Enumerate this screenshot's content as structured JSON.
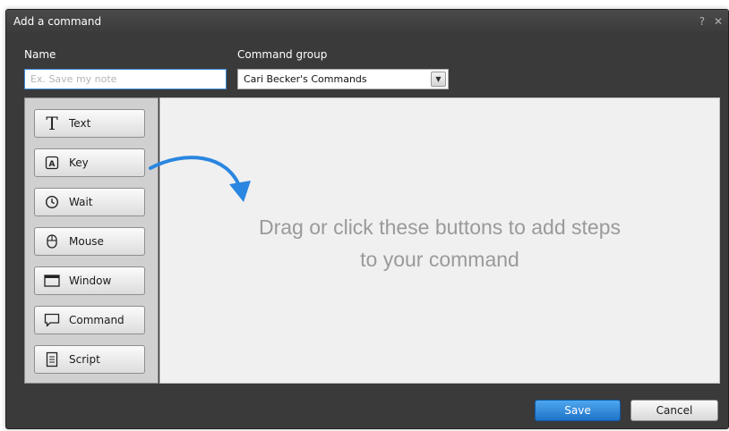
{
  "window": {
    "title": "Add a command",
    "help": "?",
    "close": "✕"
  },
  "form": {
    "name_label": "Name",
    "name_placeholder": "Ex. Save my note",
    "name_value": "",
    "group_label": "Command group",
    "group_value": "Cari Becker's Commands"
  },
  "steps": [
    {
      "label": "Text",
      "icon": "text-icon"
    },
    {
      "label": "Key",
      "icon": "key-icon"
    },
    {
      "label": "Wait",
      "icon": "clock-icon"
    },
    {
      "label": "Mouse",
      "icon": "mouse-icon"
    },
    {
      "label": "Window",
      "icon": "window-icon"
    },
    {
      "label": "Command",
      "icon": "speech-bubble-icon"
    },
    {
      "label": "Script",
      "icon": "script-icon"
    }
  ],
  "canvas": {
    "hint_line1": "Drag or click these buttons to add steps",
    "hint_line2": "to your command"
  },
  "footer": {
    "save_label": "Save",
    "cancel_label": "Cancel"
  },
  "colors": {
    "accent": "#2a86e0",
    "dialog_bg": "#3a3a3a",
    "canvas_bg": "#f0f0f0"
  }
}
